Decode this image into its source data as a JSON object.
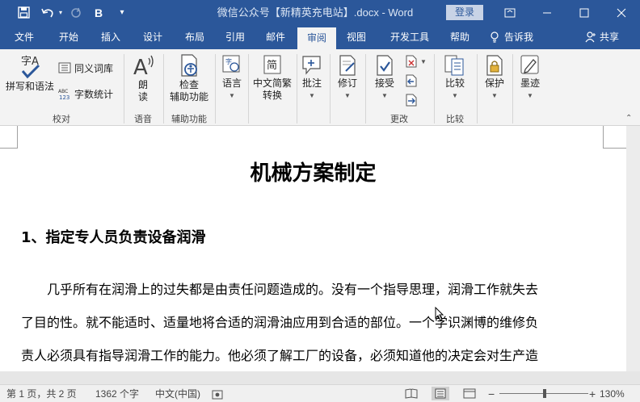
{
  "titlebar": {
    "doc_title": "微信公众号【新精英充电站】.docx  -  Word",
    "login": "登录",
    "bold_label": "B"
  },
  "tabs": [
    {
      "label": "文件"
    },
    {
      "label": "开始"
    },
    {
      "label": "插入"
    },
    {
      "label": "设计"
    },
    {
      "label": "布局"
    },
    {
      "label": "引用"
    },
    {
      "label": "邮件"
    },
    {
      "label": "审阅",
      "active": true
    },
    {
      "label": "视图"
    },
    {
      "label": "开发工具"
    },
    {
      "label": "帮助"
    }
  ],
  "tell_me": "告诉我",
  "share": "共享",
  "ribbon": {
    "proofing": {
      "spelling": "拼写和语法",
      "thesaurus": "同义词库",
      "wordcount": "字数统计",
      "group": "校对"
    },
    "speech": {
      "read_1": "朗",
      "read_2": "读",
      "group": "语音"
    },
    "accessibility": {
      "check_1": "检查",
      "check_2": "辅助功能",
      "group": "辅助功能"
    },
    "language": {
      "label": "语言"
    },
    "chinese": {
      "label_1": "中文简繁",
      "label_2": "转换"
    },
    "comments": {
      "label": "批注"
    },
    "tracking": {
      "label": "修订"
    },
    "changes": {
      "accept": "接受",
      "group": "更改"
    },
    "compare": {
      "label": "比较",
      "group": "比较"
    },
    "protect": {
      "label": "保护"
    },
    "ink": {
      "label": "墨迹"
    }
  },
  "document": {
    "heading": "机械方案制定",
    "subheading": "1、指定专人员负责设备润滑",
    "lines": [
      "几乎所有在润滑上的过失都是由责任问题造成的。没有一个指导思理，润滑工作就失去",
      "了目的性。就不能适时、适量地将合适的润滑油应用到合适的部位。一个学识渊博的维修负",
      "责人必须具有指导润滑工作的能力。他必须了解工厂的设备，必须知道他的决定会对生产造"
    ]
  },
  "status": {
    "page": "第 1 页，共 2 页",
    "words": "1362 个字",
    "language": "中文(中国)",
    "zoom": "130%",
    "zoom_level_percent": 130
  },
  "colors": {
    "accent": "#2b579a",
    "ribbon_bg": "#f3f3f3"
  }
}
